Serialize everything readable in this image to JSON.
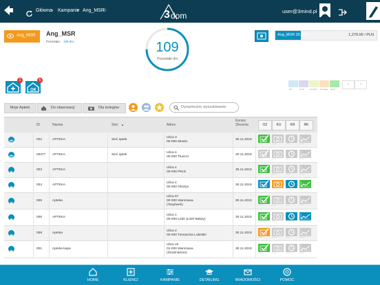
{
  "topbar": {
    "breadcrumb": [
      "Główna",
      "Kampanie",
      "Ang_MSR"
    ],
    "logo_text": "dom",
    "logo_num": "3",
    "user_email": "user@3mind.pl"
  },
  "campaign": {
    "badge_label": "Ang_MSR",
    "title": "Ang_MSR",
    "remaining_label": "Pozostało:",
    "remaining_value": "109 dni",
    "days": "109",
    "days_label": "Pozostałe dni",
    "days_fraction": 0.75,
    "progress_label": "Ang_MSR 25.40%",
    "progress_pct": 25.4,
    "progress_value": "1,270.00 / PLN"
  },
  "badges": [
    {
      "count": "1",
      "icon": "house-plus-icon"
    },
    {
      "count": "5",
      "icon": "house-ok-icon"
    }
  ],
  "legend": {
    "items": [
      {
        "label": "OK",
        "color": "#cfe8f5"
      },
      {
        "label": "stock",
        "color": "#d8d8ee"
      },
      {
        "label": "pending",
        "color": "#eef5c8"
      },
      {
        "label": "shortage",
        "color": "#fde0c0"
      },
      {
        "label": "stock",
        "color": "#a8e8a8"
      }
    ]
  },
  "filters": {
    "my_pharmacies": "Moje Apteki",
    "watched": "Do obserwacji",
    "colleagues": "Dla kolegów",
    "search_placeholder": "Dynamiczne wyszukiwanie"
  },
  "table": {
    "headers": {
      "id": "ID",
      "name": "Nazwa",
      "network": "Sieć",
      "address": "Adres",
      "end_date": "Koniec Zlecenia",
      "oz": "OZ",
      "ku": "KU",
      "kr": "KR",
      "rk": "RK"
    },
    "rows": [
      {
        "id": "002",
        "name": "APTEKA",
        "network": "Sieć aptek",
        "addr1": "Ulica 3",
        "addr2": "00-000 Miasto",
        "addr3": "",
        "date": "30.11.2019"
      },
      {
        "id": "00377",
        "name": "APTEKA",
        "network": "Sieć aptek",
        "addr1": "Ulica 4",
        "addr2": "00-000 Tłuszcz",
        "addr3": "",
        "date": "30.11.2019"
      },
      {
        "id": "003",
        "name": "APTEKA",
        "network": "",
        "addr1": "Ulica 4",
        "addr2": "00-000 Płock",
        "addr3": "",
        "date": "30.11.2019"
      },
      {
        "id": "004",
        "name": "APTEKA",
        "network": "",
        "addr1": "Ulica 4",
        "addr2": "00-000 Olsztyn",
        "addr3": "",
        "date": "30.11.2019"
      },
      {
        "id": "005",
        "name": "Apteka",
        "network": "",
        "addr1": "Ulica 67",
        "addr2": "00-000 Warszawa",
        "addr3": "(Targówek)",
        "date": "30.11.2019"
      },
      {
        "id": "006",
        "name": "APTEKA",
        "network": "",
        "addr1": "Ulica 1",
        "addr2": "00-000 Łódź (Łódź-Bałuty)",
        "addr3": "",
        "date": "30.11.2019"
      },
      {
        "id": "008",
        "name": "Apteka",
        "network": "",
        "addr1": "Ulica 2",
        "addr2": "00-000 Tomaszów Lubelski",
        "addr3": "",
        "date": "30.11.2019"
      },
      {
        "id": "001",
        "name": "Apteka kapa",
        "network": "",
        "addr1": "Ulica 16",
        "addr2": "01-000 Warszawa",
        "addr3": "(Śródmieście)",
        "date": "30.11.2019"
      }
    ]
  },
  "nav": {
    "home": "HOME",
    "clients": "KLIENCI",
    "campaigns": "KAMPANIE",
    "detailing": "DETAILING",
    "messages": "WIADOMOŚCI",
    "help": "POMOC"
  }
}
